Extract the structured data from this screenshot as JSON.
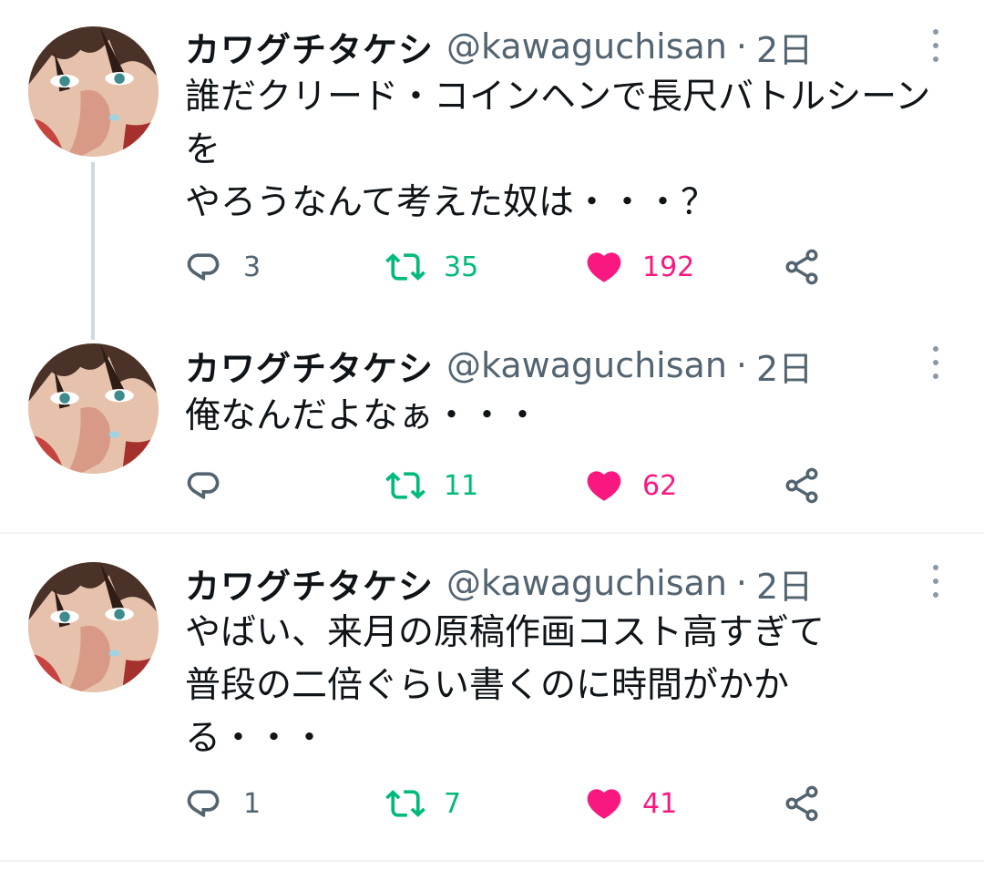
{
  "colors": {
    "text": "#0f1419",
    "secondary": "#536471",
    "retweet": "#00ba7c",
    "like": "#f91880",
    "divider": "#eff3f4",
    "thread_line": "#cfd9de"
  },
  "icons": {
    "reply": "reply-icon",
    "retweet": "retweet-icon",
    "like": "heart-icon",
    "share": "share-icon",
    "more": "more-vertical-icon"
  },
  "tweets": [
    {
      "name": "カワグチタケシ",
      "handle": "@kawaguchisan",
      "separator": "·",
      "time": "2日",
      "text": "誰だクリード・コインヘンで長尺バトルシーンを\nやろうなんて考えた奴は・・・？",
      "replies": "3",
      "retweets": "35",
      "likes": "192"
    },
    {
      "name": "カワグチタケシ",
      "handle": "@kawaguchisan",
      "separator": "·",
      "time": "2日",
      "text": "俺なんだよなぁ・・・",
      "replies": "",
      "retweets": "11",
      "likes": "62"
    },
    {
      "name": "カワグチタケシ",
      "handle": "@kawaguchisan",
      "separator": "·",
      "time": "2日",
      "text": "やばい、来月の原稿作画コスト高すぎて\n普段の二倍ぐらい書くのに時間がかか\nる・・・",
      "replies": "1",
      "retweets": "7",
      "likes": "41"
    }
  ]
}
